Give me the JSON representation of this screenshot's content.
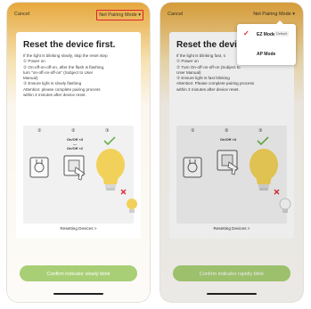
{
  "left_screen": {
    "cancel_label": "Cancel",
    "mode_label": "Net Pairing Mode ▾",
    "title": "Reset the device first.",
    "instructions": [
      "If the light is blinking slowly, skip the reset step",
      "① Power on",
      "② On-off-on-off-on, after the flash is flashing,",
      "turn \"on-off-on-off-on\" (Subject to User",
      "Manual)",
      "③ Ensure light is slowly flashing",
      "Attention: please complete pairing process",
      "within 3 minutes after device reset."
    ],
    "steps": [
      "①",
      "②",
      "③"
    ],
    "reset_times": [
      "On/Off ×3",
      "On/Off ×2"
    ],
    "reset_link": "Resetting Devices >",
    "confirm_label": "Confirm indicator slowly blink"
  },
  "right_screen": {
    "cancel_label": "Cancel",
    "mode_label": "Net Pairing Mode ▾",
    "title": "Reset the devic",
    "instructions": [
      "If the light is blinking fast, s",
      "① Power on",
      "② Turn On-off-on-off-on (Subject to",
      "User Manual)",
      "③ Ensure light is fast blinking",
      "Attention: Please complete pairing process",
      "within 3 minutes after device reset."
    ],
    "steps": [
      "①",
      "②",
      "③"
    ],
    "reset_times": [
      "On/Off ×3"
    ],
    "reset_link": "Resetting Devices >",
    "confirm_label": "Confirm indicator rapidly blink",
    "dropdown": {
      "options": [
        {
          "label": "EZ Mode",
          "badge": "Default",
          "selected": true
        },
        {
          "label": "AP Mode",
          "badge": "",
          "selected": false
        }
      ]
    }
  },
  "colors": {
    "header_orange": "#e6a83d",
    "accent_red": "#e0232b",
    "confirm_green": "#a9cf76",
    "check_green": "#6ab04c",
    "bulb_yellow": "#f2d15a"
  }
}
